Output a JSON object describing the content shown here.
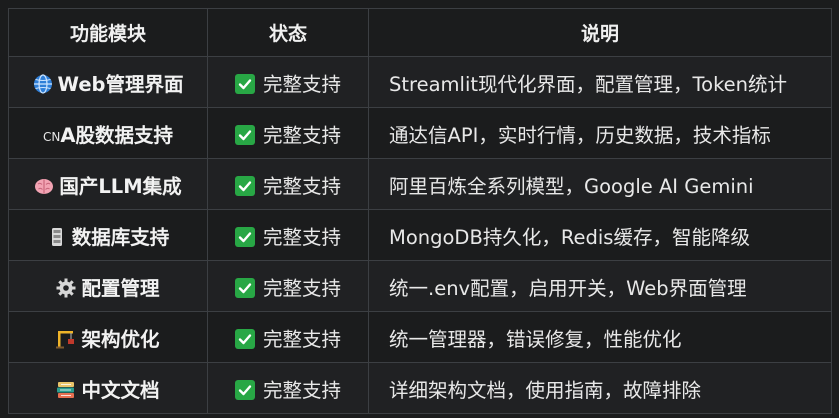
{
  "headers": {
    "feature": "功能模块",
    "status": "状态",
    "desc": "说明"
  },
  "rows": [
    {
      "icon": "globe-icon",
      "feature": "Web管理界面",
      "status": "完整支持",
      "desc": "Streamlit现代化界面，配置管理，Token统计"
    },
    {
      "icon": "cn-flag-icon",
      "icon_text": "CN",
      "feature": "A股数据支持",
      "status": "完整支持",
      "desc": "通达信API，实时行情，历史数据，技术指标"
    },
    {
      "icon": "brain-icon",
      "feature": "国产LLM集成",
      "status": "完整支持",
      "desc": "阿里百炼全系列模型，Google AI Gemini"
    },
    {
      "icon": "database-icon",
      "feature": "数据库支持",
      "status": "完整支持",
      "desc": "MongoDB持久化，Redis缓存，智能降级"
    },
    {
      "icon": "gear-icon",
      "feature": "配置管理",
      "status": "完整支持",
      "desc": "统一.env配置，启用开关，Web界面管理"
    },
    {
      "icon": "construction-icon",
      "feature": "架构优化",
      "status": "完整支持",
      "desc": "统一管理器，错误修复，性能优化"
    },
    {
      "icon": "books-icon",
      "feature": "中文文档",
      "status": "完整支持",
      "desc": "详细架构文档，使用指南，故障排除"
    }
  ],
  "colors": {
    "check_bg": "#28a745",
    "border": "#3c3f43",
    "background": "#1b1c1d",
    "row_alt": "#202123"
  }
}
